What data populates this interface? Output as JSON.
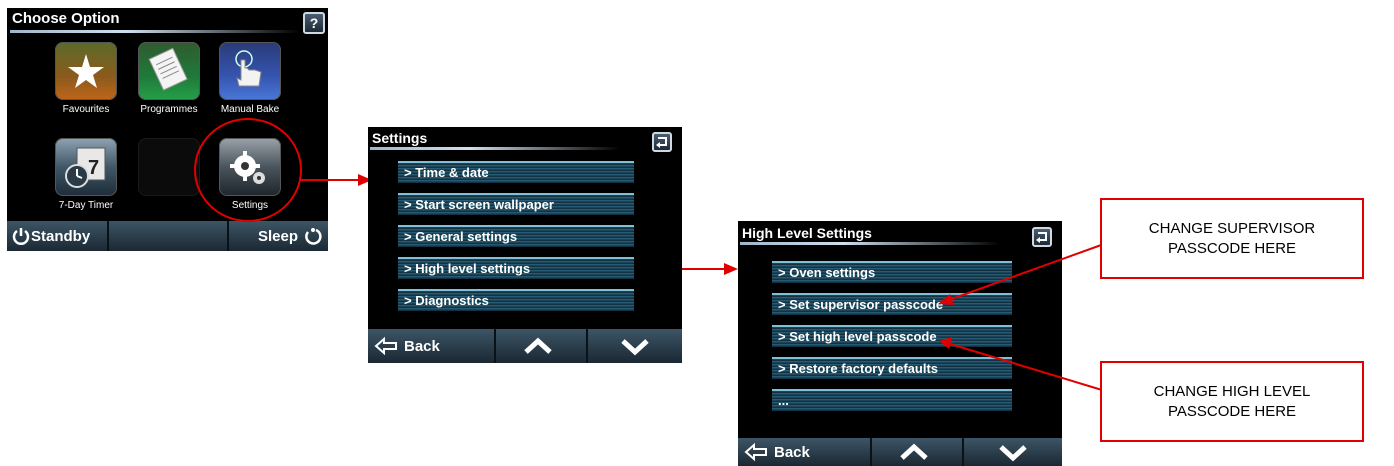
{
  "choose_option": {
    "title": "Choose Option",
    "help_label": "?",
    "tiles": [
      {
        "label": "Favourites",
        "icon": "star-icon"
      },
      {
        "label": "Programmes",
        "icon": "document-icon"
      },
      {
        "label": "Manual Bake",
        "icon": "hand-pointer-icon"
      },
      {
        "label": "7-Day Timer",
        "icon": "clock-calendar-icon"
      },
      {
        "label": "",
        "icon": "empty-tile"
      },
      {
        "label": "Settings",
        "icon": "gears-icon"
      }
    ],
    "standby_label": "Standby",
    "sleep_label": "Sleep"
  },
  "settings": {
    "title": "Settings",
    "items": [
      "> Time & date",
      "> Start screen wallpaper",
      "> General settings",
      "> High level settings",
      "> Diagnostics"
    ],
    "back_label": "Back"
  },
  "high_level": {
    "title": "High Level Settings",
    "items": [
      "> Oven settings",
      "> Set supervisor passcode",
      "> Set high level passcode",
      "> Restore factory defaults",
      "..."
    ],
    "back_label": "Back"
  },
  "callouts": {
    "supervisor": "CHANGE SUPERVISOR PASSCODE HERE",
    "high_level": "CHANGE HIGH LEVEL PASSCODE HERE"
  },
  "colors": {
    "annotation_red": "#e00000",
    "menu_teal": "#2d6a82"
  }
}
